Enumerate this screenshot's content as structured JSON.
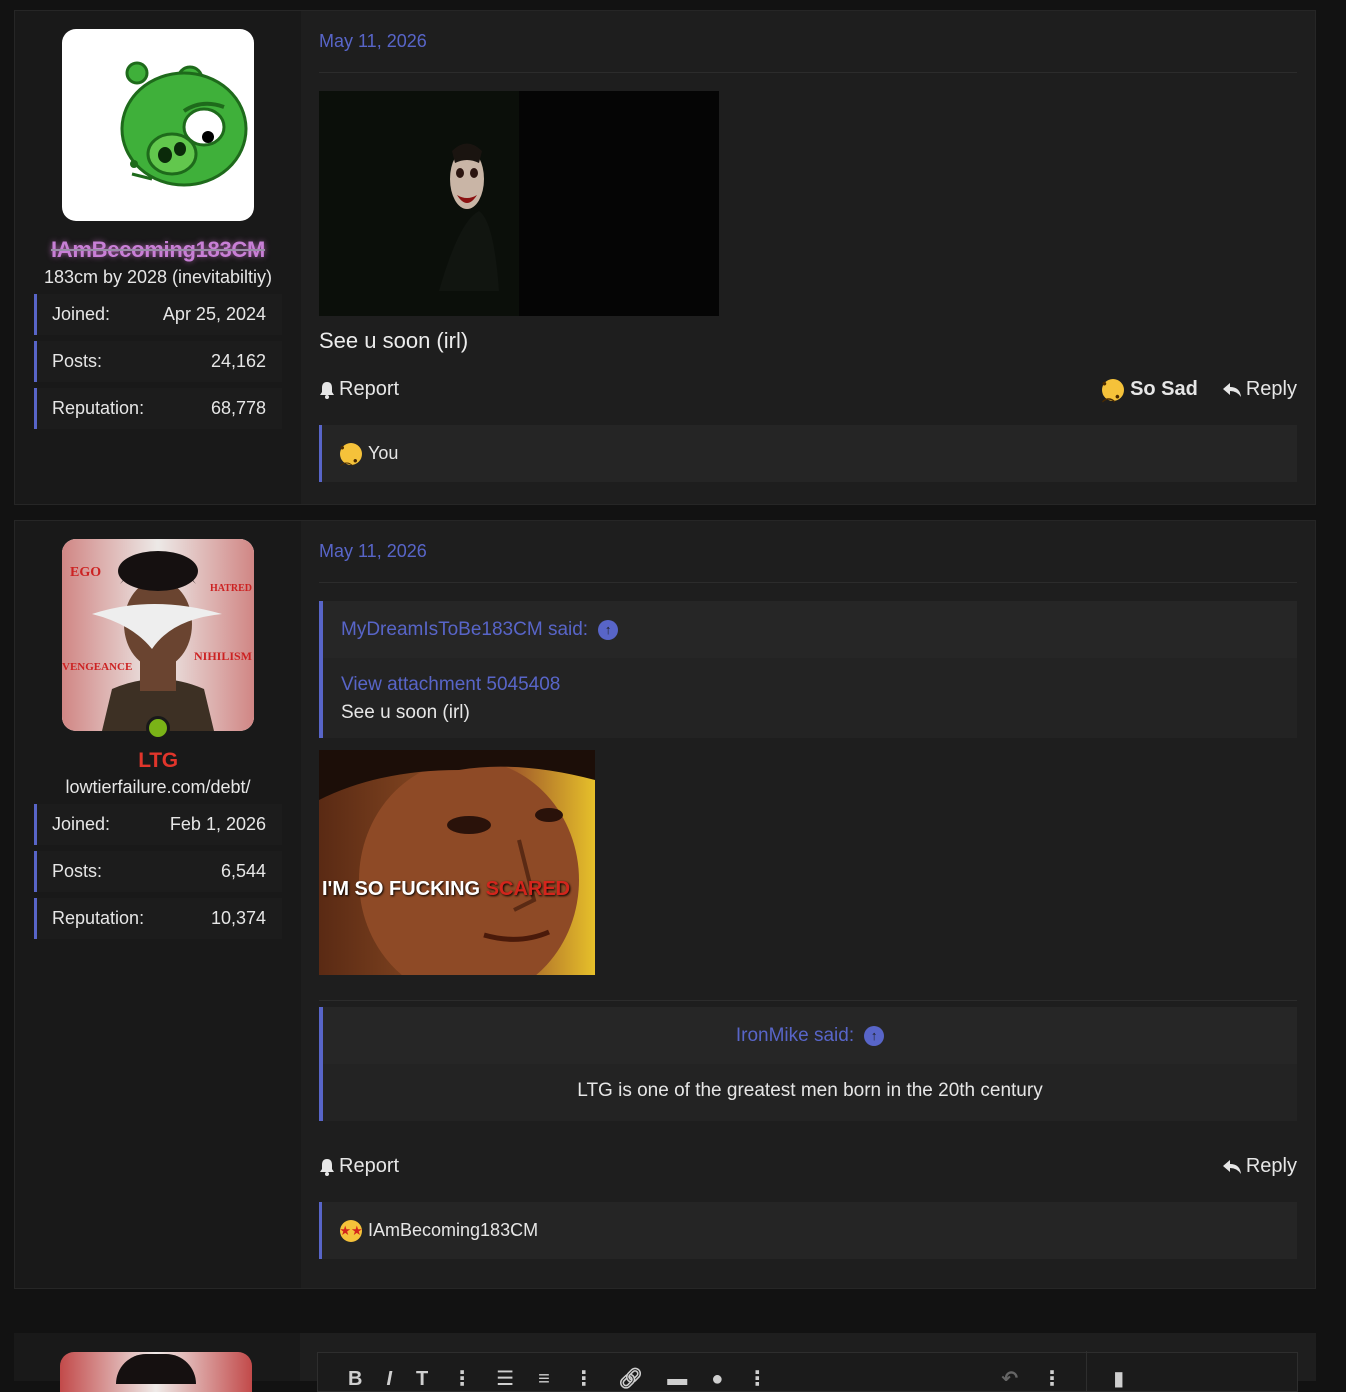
{
  "posts": [
    {
      "user": {
        "name": "IAmBecoming183CM",
        "title": "183cm by 2028 (inevitabiltiy)",
        "joined_label": "Joined:",
        "joined": "Apr 25, 2024",
        "posts_label": "Posts:",
        "posts": "24,162",
        "rep_label": "Reputation:",
        "rep": "68,778"
      },
      "date": "May 11, 2026",
      "text": "See u soon (irl)",
      "report": "Report",
      "reaction_label": "So Sad",
      "reply": "Reply",
      "reactions_text": "You"
    },
    {
      "user": {
        "name": "LTG",
        "title": "lowtierfailure.com/debt/",
        "joined_label": "Joined:",
        "joined": "Feb 1, 2026",
        "posts_label": "Posts:",
        "posts": "6,544",
        "rep_label": "Reputation:",
        "rep": "10,374",
        "avatar_words": [
          "EGO",
          "HATRED",
          "NIHILISM",
          "VENGEANCE"
        ]
      },
      "date": "May 11, 2026",
      "quote1": {
        "author": "MyDreamIsToBe183CM said:",
        "attachment": "View attachment 5045408",
        "text": "See u soon (irl)"
      },
      "image_caption_1": "I'M SO FUCKING ",
      "image_caption_2": "SCARED",
      "quote2": {
        "author": "IronMike said:",
        "text": "LTG is one of the greatest men born in the 20th century"
      },
      "report": "Report",
      "reply": "Reply",
      "reactions_text": "IAmBecoming183CM"
    }
  ],
  "colors": {
    "accent": "#5865c8",
    "bg": "#121212",
    "panel": "#1e1e1e",
    "ltg_red": "#e0352b"
  }
}
